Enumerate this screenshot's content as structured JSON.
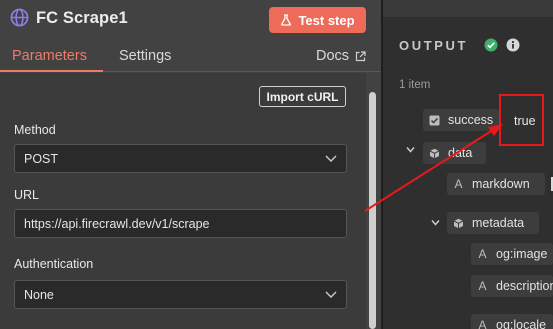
{
  "header": {
    "node_title": "FC Scrape1",
    "test_step_label": "Test step",
    "node_icon": "globe-icon",
    "test_step_icon": "flask-icon"
  },
  "tabs": {
    "parameters": "Parameters",
    "settings": "Settings",
    "docs": "Docs",
    "docs_icon": "external-link-icon"
  },
  "form": {
    "import_curl_label": "Import cURL",
    "method_label": "Method",
    "method_value": "POST",
    "url_label": "URL",
    "url_value": "https://api.firecrawl.dev/v1/scrape",
    "auth_label": "Authentication",
    "auth_value": "None"
  },
  "output": {
    "title": "OUTPUT",
    "status_icon": "check-circle-icon",
    "info_icon": "info-icon",
    "item_count": "1 item",
    "tree": {
      "success_key": "success",
      "success_value": "true",
      "data_key": "data",
      "markdown_key": "markdown",
      "metadata_key": "metadata",
      "og_image_key": "og:image",
      "description_key": "description",
      "og_locale_key": "og:locale"
    }
  },
  "colors": {
    "accent": "#ef7a66",
    "test_button": "#ee6a59",
    "success_green": "#3fae6b",
    "highlight_red": "#e8191a"
  }
}
